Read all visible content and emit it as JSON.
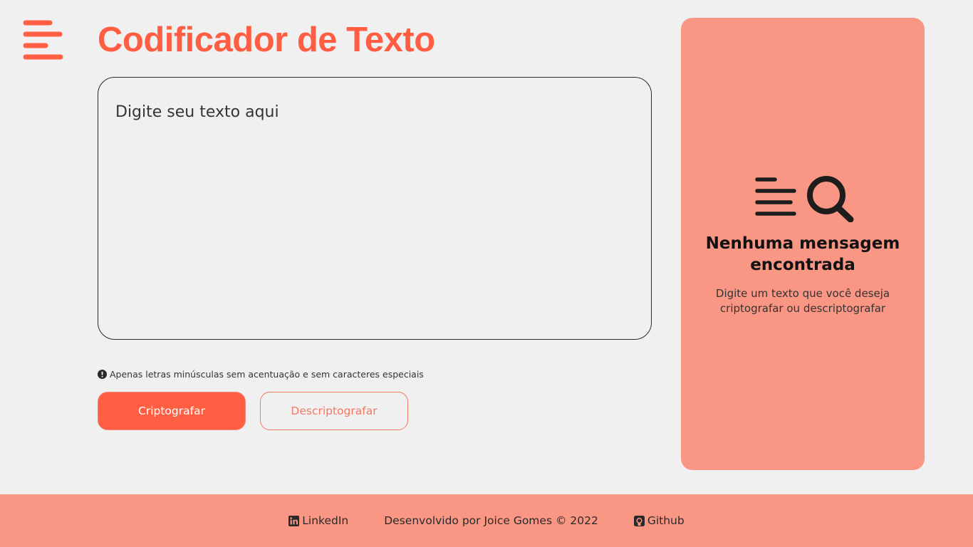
{
  "header": {
    "menu_icon": "hamburger-menu-icon",
    "title": "Codificador de Texto"
  },
  "editor": {
    "placeholder": "Digite seu texto aqui"
  },
  "hint": {
    "icon": "exclamation-circle-icon",
    "text": "Apenas letras minúsculas sem acentuação e sem caracteres especiais"
  },
  "actions": {
    "encrypt_label": "Criptografar",
    "decrypt_label": "Descriptografar"
  },
  "result_panel": {
    "icon": "text-search-icon",
    "title": "Nenhuma mensagem encontrada",
    "description": "Digite um texto que você deseja criptografar ou descriptografar"
  },
  "footer": {
    "linkedin_label": "LinkedIn",
    "credit": "Desenvolvido por Joice Gomes © 2022",
    "github_label": "Github"
  },
  "colors": {
    "accent": "#ff5e42",
    "panel": "#fa9684",
    "background": "#f1f0f0"
  }
}
